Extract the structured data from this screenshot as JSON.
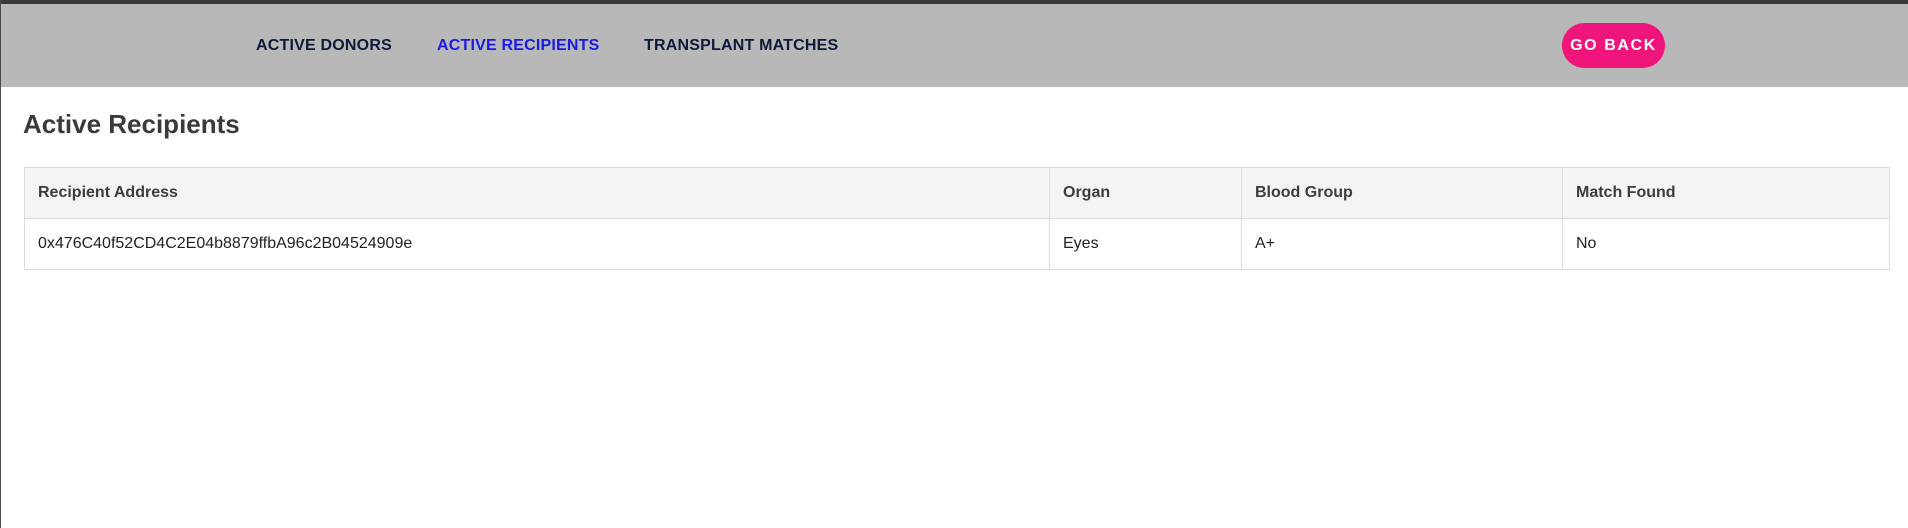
{
  "nav": {
    "links": [
      {
        "label": "ACTIVE DONORS",
        "active": false
      },
      {
        "label": "ACTIVE RECIPIENTS",
        "active": true
      },
      {
        "label": "TRANSPLANT MATCHES",
        "active": false
      }
    ],
    "go_back_label": "GO BACK"
  },
  "page": {
    "title": "Active Recipients"
  },
  "table": {
    "headers": [
      "Recipient Address",
      "Organ",
      "Blood Group",
      "Match Found"
    ],
    "rows": [
      [
        "0x476C40f52CD4C2E04b8879ffbA96c2B04524909e",
        "Eyes",
        "A+",
        "No"
      ]
    ]
  },
  "colors": {
    "navbar_bg": "#b8b8b8",
    "nav_link": "#0d1a3a",
    "nav_link_active": "#1a1ae6",
    "go_back_bg": "#f0157a",
    "table_header_bg": "#f4f4f4"
  }
}
